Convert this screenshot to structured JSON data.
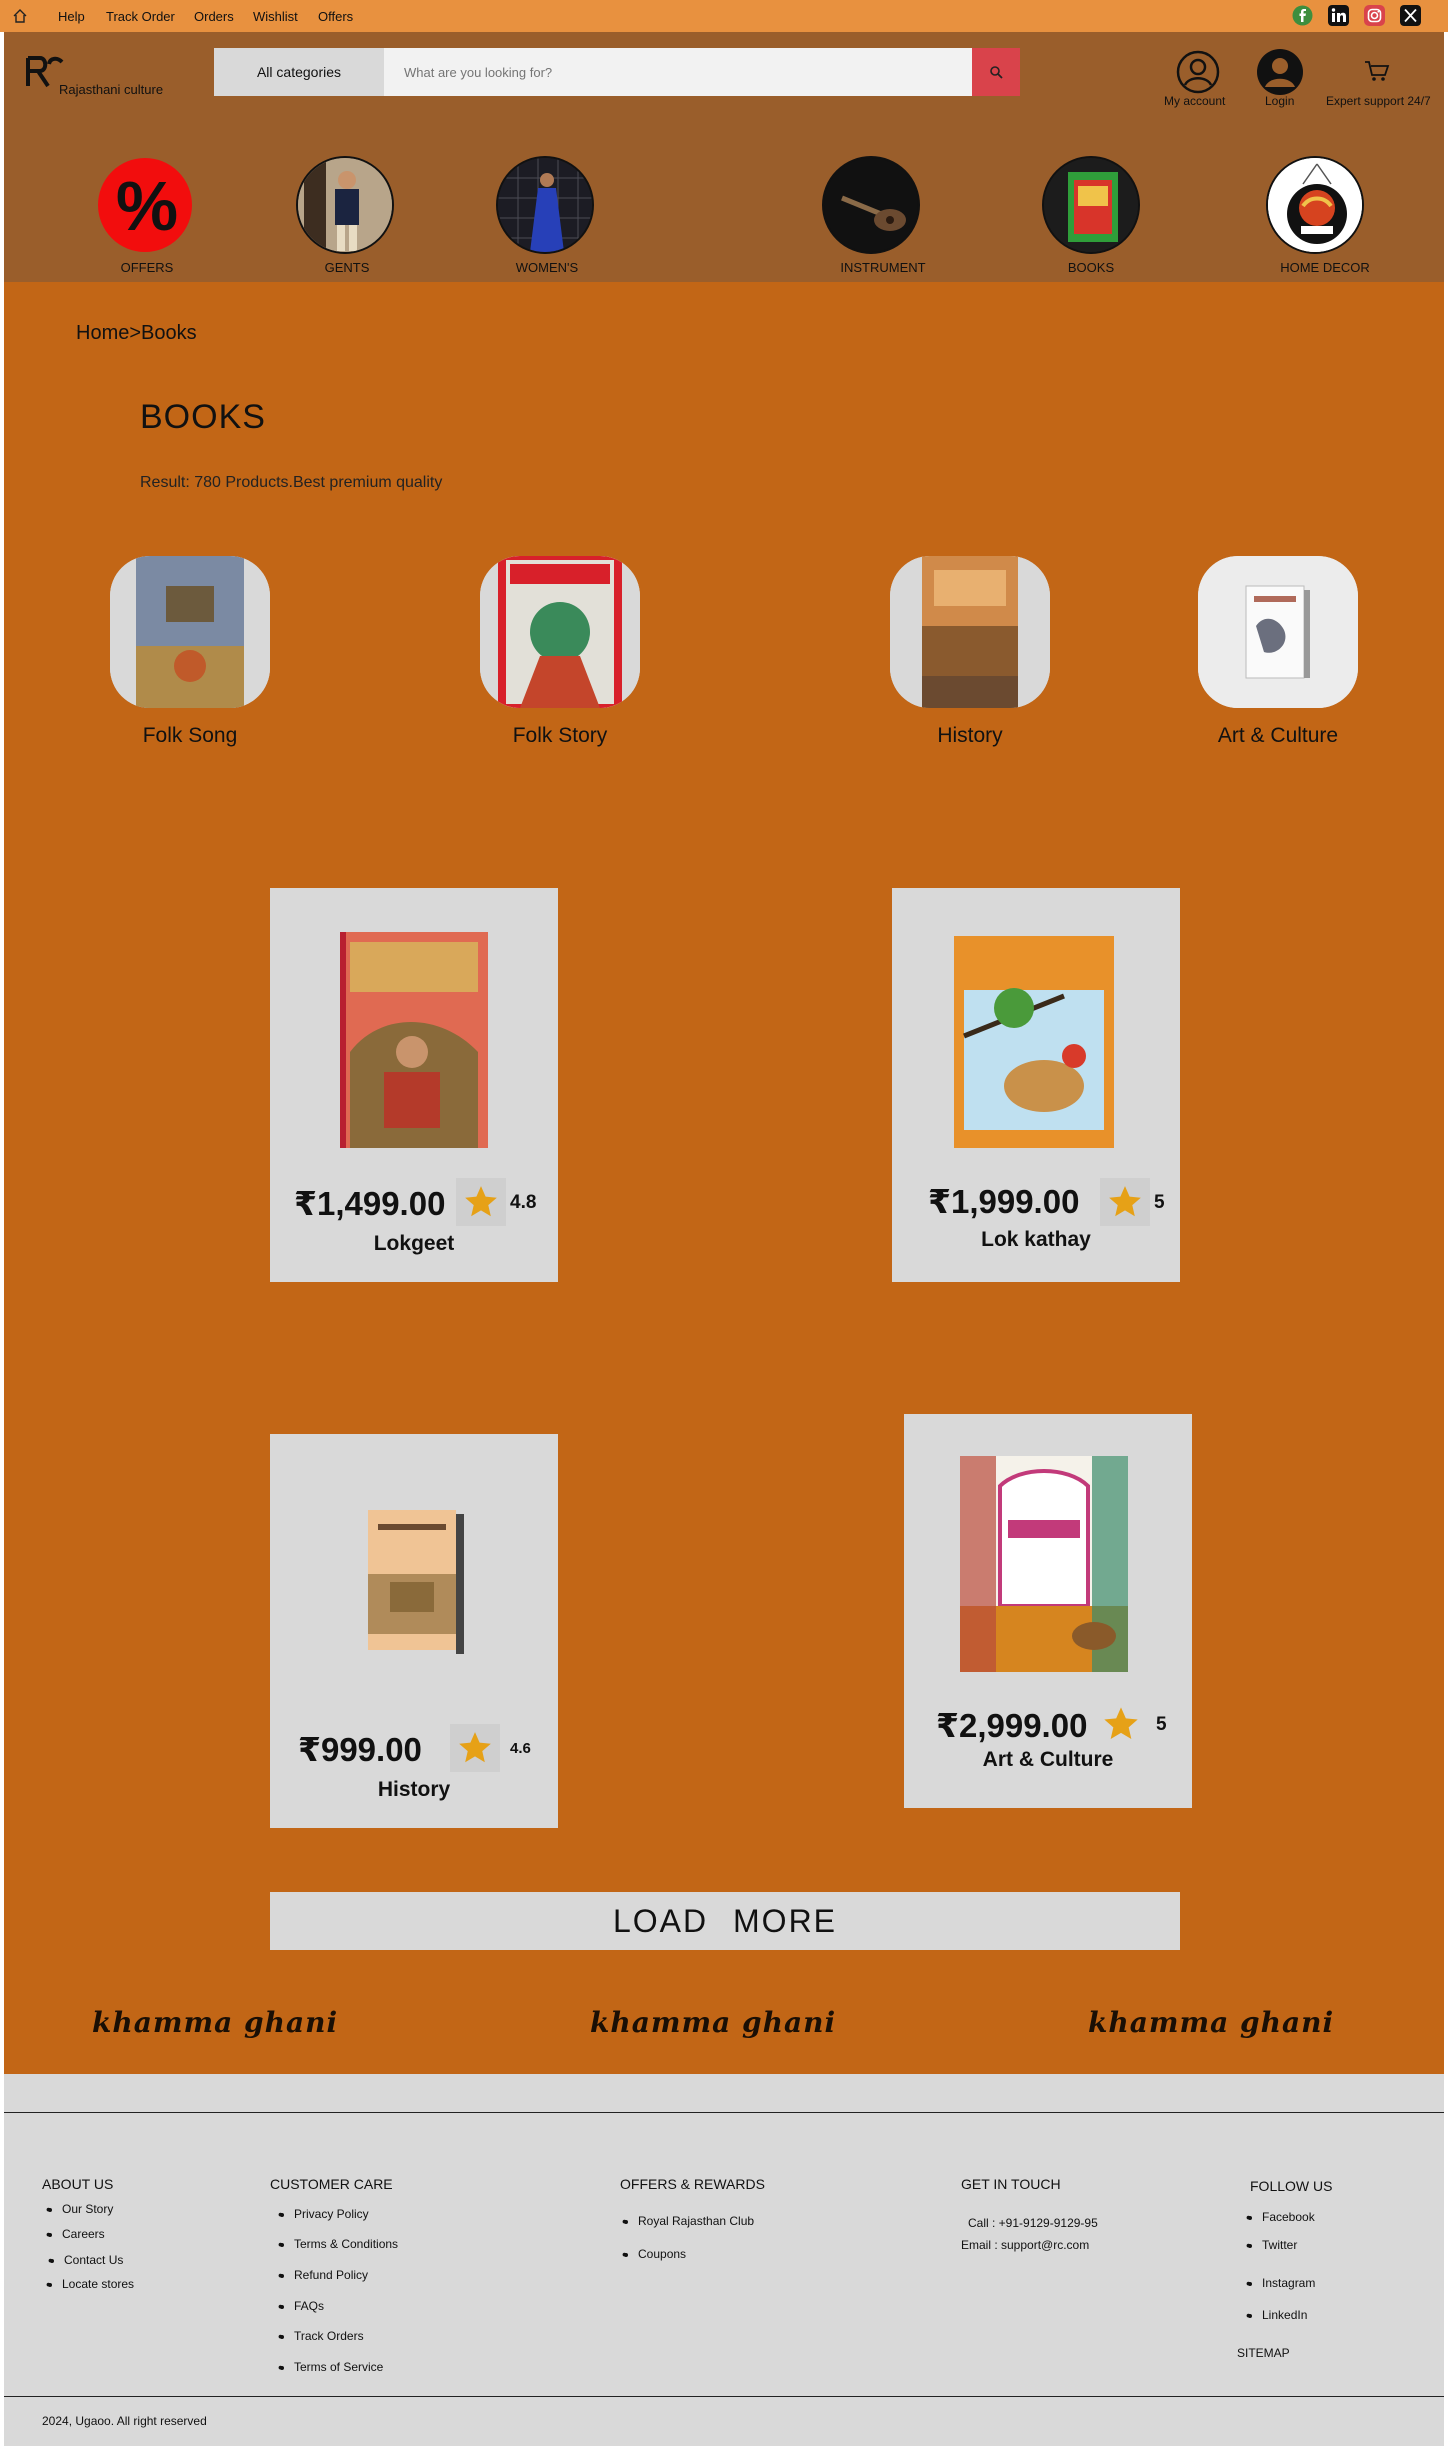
{
  "topbar": {
    "nav": [
      "Help",
      "Track Order",
      "Orders",
      "Wishlist",
      "Offers"
    ],
    "social": [
      "facebook-icon",
      "linkedin-icon",
      "instagram-icon",
      "x-icon"
    ]
  },
  "header": {
    "brand": "Rajasthani culture",
    "category_button": "All categories",
    "search_placeholder": "What are you looking for?",
    "my_account": "My account",
    "login": "Login",
    "support": "Expert support 24/7"
  },
  "categories": [
    "OFFERS",
    "GENTS",
    "WOMEN'S",
    "INSTRUMENT",
    "BOOKS",
    "HOME DECOR"
  ],
  "main": {
    "breadcrumb": "Home>Books",
    "title": "BOOKS",
    "result": "Result: 780 Products.Best premium quality",
    "subcategories": [
      "Folk Song",
      "Folk Story",
      "History",
      "Art & Culture"
    ],
    "products": [
      {
        "price": "₹1,499.00",
        "rating": "4.8",
        "name": "Lokgeet"
      },
      {
        "price": "₹1,999.00",
        "rating": "5",
        "name": "Lok kathay"
      },
      {
        "price": "₹999.00",
        "rating": "4.6",
        "name": "History"
      },
      {
        "price": "₹2,999.00",
        "rating": "5",
        "name": "Art & Culture"
      }
    ],
    "load_more": "LOAD MORE",
    "tagline": "khamma ghani",
    "colors": {
      "accent": "#c26616",
      "topbar": "#e8913f",
      "header": "#9a5e2b",
      "search_button": "#d9434b",
      "star": "#e6a117"
    }
  },
  "footer": {
    "about": {
      "title": "ABOUT US",
      "items": [
        "Our Story",
        "Careers",
        "Contact Us",
        "Locate stores"
      ]
    },
    "care": {
      "title": "CUSTOMER CARE",
      "items": [
        "Privacy Policy",
        "Terms & Conditions",
        "Refund Policy",
        "FAQs",
        "Track Orders",
        "Terms of Service"
      ]
    },
    "offers": {
      "title": "OFFERS & REWARDS",
      "items": [
        "Royal Rajasthan Club",
        "Coupons"
      ]
    },
    "touch": {
      "title": "GET IN TOUCH",
      "call": "Call : +91-9129-9129-95",
      "email": "Email : support@rc.com"
    },
    "follow": {
      "title": "FOLLOW US",
      "items": [
        "Facebook",
        "Twitter",
        "Instagram",
        "LinkedIn"
      ]
    },
    "sitemap": "SITEMAP",
    "copyright": "2024, Ugaoo. All right reserved"
  }
}
